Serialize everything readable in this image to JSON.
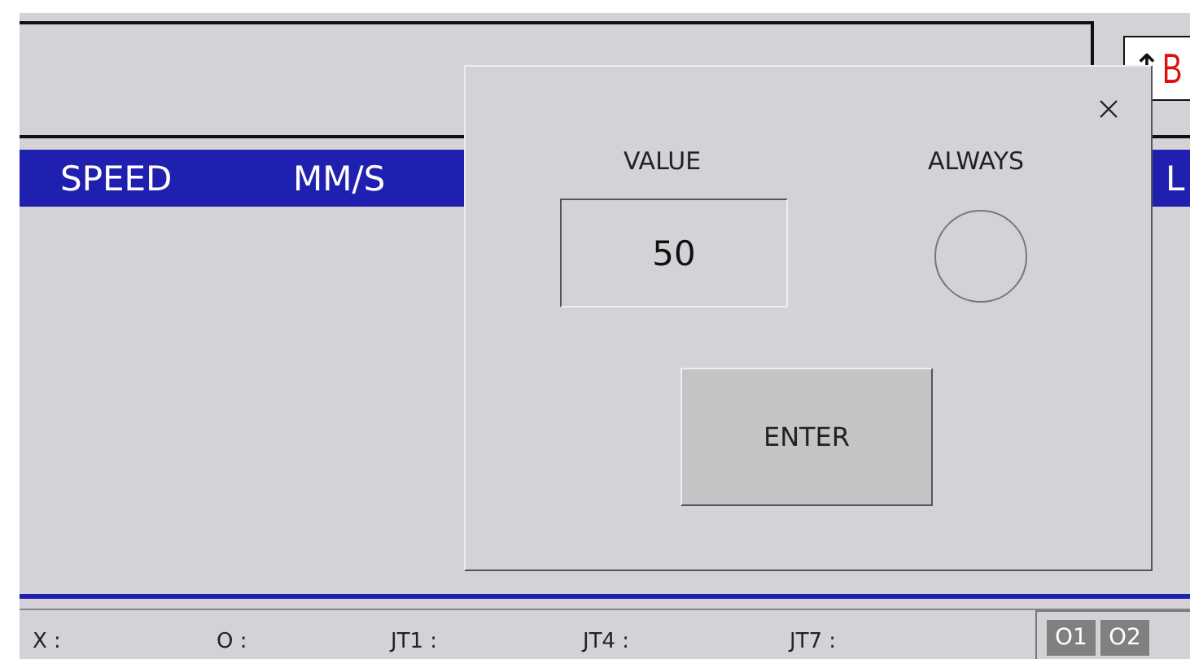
{
  "background": {
    "top_right_badge": {
      "arrow": "↑",
      "text": "B"
    },
    "header_bar": {
      "columns": [
        "SPEED",
        "MM/S",
        "L"
      ]
    },
    "status_row": {
      "labels": [
        "X :",
        "O :",
        "JT1 :",
        "JT4 :",
        "JT7 :"
      ],
      "buttons": [
        {
          "label": "O1"
        },
        {
          "label": "O2"
        }
      ]
    }
  },
  "dialog": {
    "value_label": "VALUE",
    "value": "50",
    "always_label": "ALWAYS",
    "always_on": false,
    "enter": "ENTER"
  }
}
